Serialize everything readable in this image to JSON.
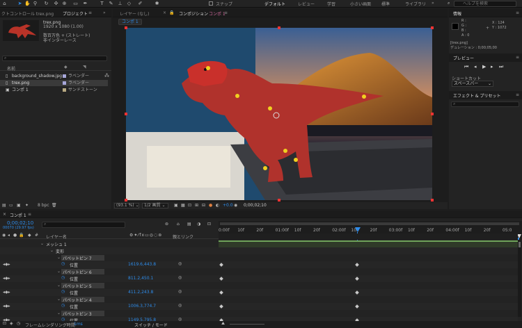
{
  "colors": {
    "accent": "#2d8ceb",
    "label_lavender": "#a7a7d9",
    "label_sandstone": "#b8a982",
    "selection_red": "#e33",
    "keyframe": "#c8c8c8"
  },
  "toolbar": {
    "icons": [
      "home-icon",
      "arrow-select-icon",
      "hand-icon",
      "zoom-icon",
      "rotate-icon",
      "orbit-icon",
      "pan-behind-icon",
      "rectangle-icon",
      "pen-icon",
      "type-icon",
      "brush-icon",
      "clone-stamp-icon",
      "eraser-icon",
      "roto-brush-icon",
      "puppet-pin-icon"
    ],
    "snap_label": "スナップ",
    "workspaces": [
      "デフォルト",
      "レビュー",
      "学習",
      "小さい画面",
      "標準",
      "ライブラリ"
    ],
    "help_placeholder": "ヘルプを検索"
  },
  "project": {
    "tab_left": "クトコントロール trex.png",
    "tab": "プロジェクト",
    "file_name": "trex.png",
    "file_info_1": "1920 x 1080 (1.00)",
    "file_info_2": "数百万色 + (ストレート)",
    "file_info_3": "非インターレース",
    "search_placeholder": "",
    "header_name": "名前",
    "items": [
      {
        "name": "background_shadow.jpg",
        "label": "ラベンダー"
      },
      {
        "name": "trex.png",
        "label": "ラベンダー"
      },
      {
        "name": "コンポ 1",
        "label": "サンドストーン"
      }
    ],
    "bpc": "8 bpc"
  },
  "viewer": {
    "tab_layer": "レイヤー (なし)",
    "tab_comp": "コンポジション",
    "tab_comp_name": "コンポ 1",
    "breadcrumb": "コンポ 1",
    "zoom": "(93.1 %)",
    "resolution": "1/2 画質",
    "exposure": "+0.0",
    "timecode": "0;00;02;10"
  },
  "info": {
    "tab": "情報",
    "r": "R :",
    "g": "G :",
    "b": "B :",
    "a": "A : 0",
    "x": "X : 124",
    "y": "Y : 1072",
    "file": "[trex.png]",
    "duration": "デュレーション : 0;00;05;00"
  },
  "preview": {
    "tab": "プレビュー",
    "shortcut_label": "ショートカット",
    "shortcut_value": "スペースバー"
  },
  "effects": {
    "tab": "エフェクト & プリセット",
    "search_placeholder": ""
  },
  "timeline": {
    "tab": "コンポ 1",
    "timecode": "0;00;02;10",
    "frame_info": "00070 (29.97 fps)",
    "col_layer": "レイヤー名",
    "col_parent": "親とリンク",
    "rows": [
      {
        "name": "メッシュ 1",
        "value": ""
      },
      {
        "name": "変形",
        "value": ""
      },
      {
        "name": "パペットピン 7",
        "value": ""
      },
      {
        "name": "位置",
        "value": "1619.6,443.8"
      },
      {
        "name": "パペットピン 6",
        "value": ""
      },
      {
        "name": "位置",
        "value": "811.2,450.1"
      },
      {
        "name": "パペットピン 5",
        "value": ""
      },
      {
        "name": "位置",
        "value": "411.2,243.8"
      },
      {
        "name": "パペットピン 4",
        "value": ""
      },
      {
        "name": "位置",
        "value": "1006.3,774.7"
      },
      {
        "name": "パペットピン 3",
        "value": ""
      },
      {
        "name": "位置",
        "value": "1149.5,795.8"
      }
    ],
    "ruler": [
      "0:00f",
      "10f",
      "20f",
      "01:00f",
      "10f",
      "20f",
      "02:00f",
      "10f",
      "20f",
      "03:00f",
      "10f",
      "20f",
      "04:00f",
      "10f",
      "20f",
      "05:0"
    ],
    "footer_render": "フレームレンダリング時間",
    "footer_render_value": "1ms",
    "footer_switch": "スイッチ / モード"
  }
}
